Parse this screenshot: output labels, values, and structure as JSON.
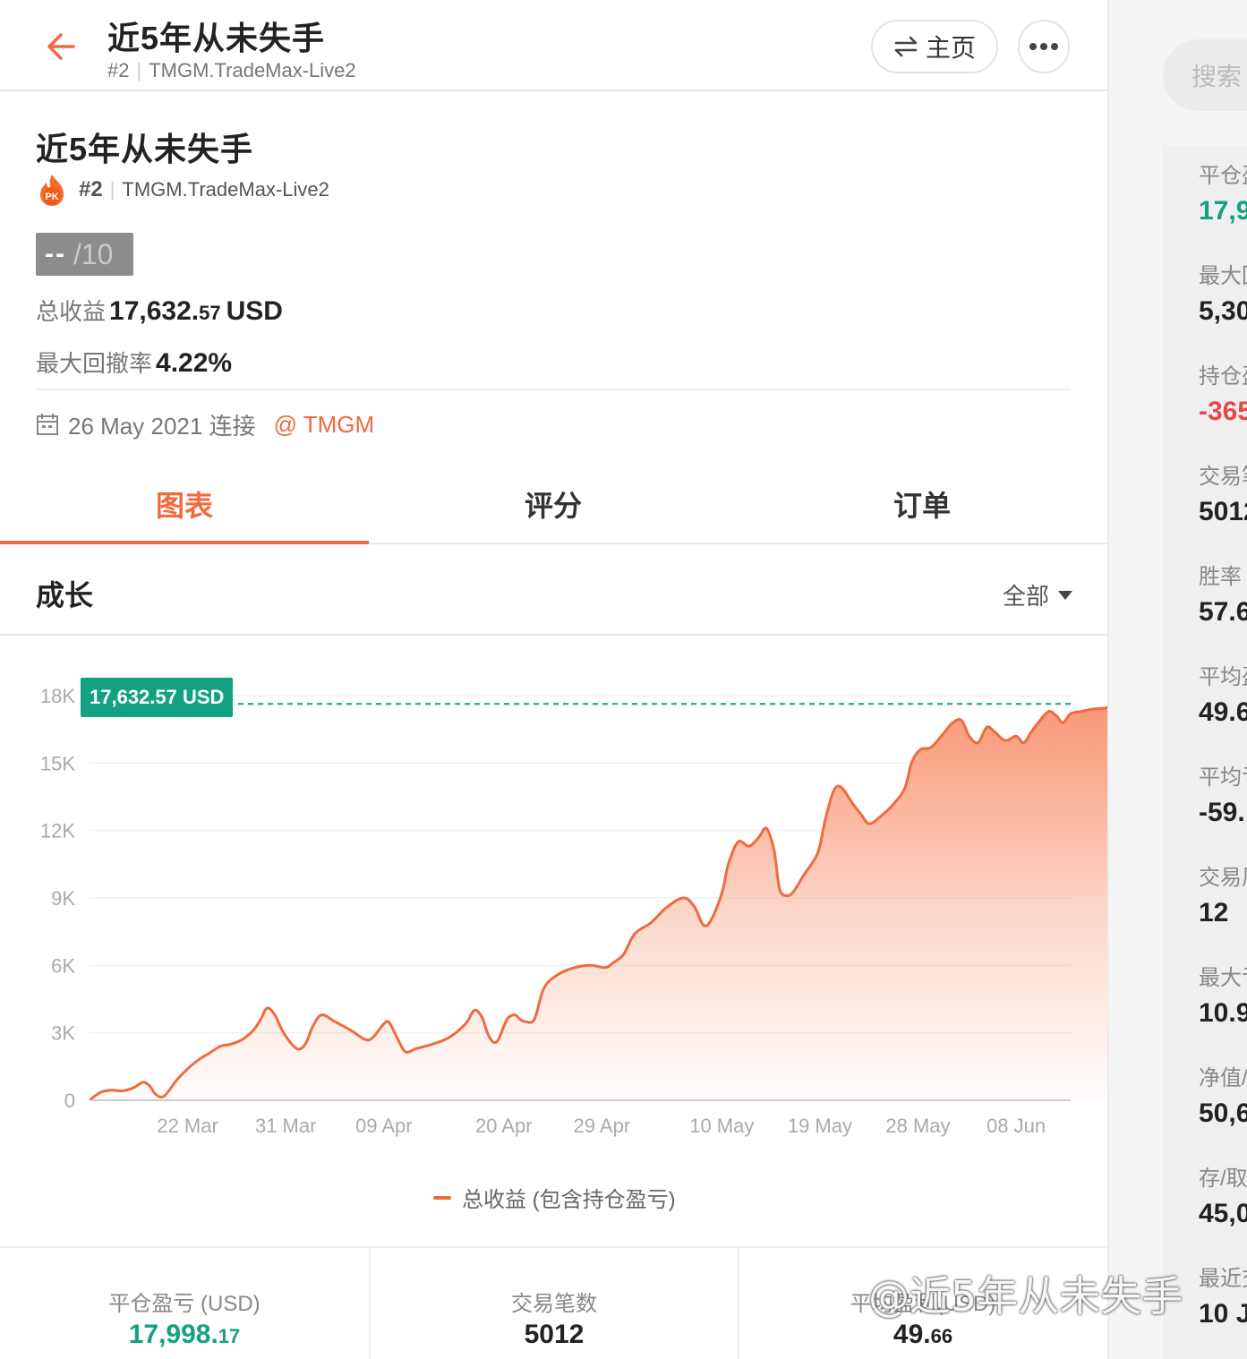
{
  "header": {
    "title": "近5年从未失手",
    "rank": "#2",
    "server": "TMGM.TradeMax-Live2",
    "home_label": "主页"
  },
  "profile": {
    "title": "近5年从未失手",
    "rank": "#2",
    "server": "TMGM.TradeMax-Live2",
    "score_dash": "--",
    "score_den": "/10",
    "total_profit_label": "总收益",
    "total_profit_int": "17,632.",
    "total_profit_frac": "57",
    "total_profit_unit": "USD",
    "drawdown_label": "最大回撤率",
    "drawdown_value": "4.22%",
    "connect_text": "26 May 2021 连接",
    "broker_link": "@ TMGM"
  },
  "tabs": [
    {
      "label": "图表",
      "active": true
    },
    {
      "label": "评分",
      "active": false
    },
    {
      "label": "订单",
      "active": false
    }
  ],
  "section": {
    "title": "成长",
    "range": "全部"
  },
  "chart_data": {
    "type": "area",
    "title": "",
    "legend": [
      "总收益 (包含持仓盈亏)"
    ],
    "current_value_tag": "17,632.57 USD",
    "y_ticks": [
      "0",
      "3K",
      "6K",
      "9K",
      "12K",
      "15K",
      "18K"
    ],
    "ylim": [
      0,
      18000
    ],
    "x_ticks": [
      "22 Mar",
      "31 Mar",
      "09 Apr",
      "20 Apr",
      "29 Apr",
      "10 May",
      "19 May",
      "28 May",
      "08 Jun"
    ],
    "x_tick_days": [
      9,
      18,
      27,
      38,
      47,
      58,
      67,
      76,
      85
    ],
    "x_range_days": [
      0,
      90
    ],
    "grid": true,
    "line_color": "#f06a3e",
    "fill_color": "#f7906a",
    "tag_color": "#13a182",
    "series": [
      {
        "name": "总收益 (包含持仓盈亏)",
        "points": [
          [
            0,
            0
          ],
          [
            1,
            350
          ],
          [
            2,
            450
          ],
          [
            3,
            420
          ],
          [
            4,
            550
          ],
          [
            4.5,
            700
          ],
          [
            5,
            800
          ],
          [
            5.5,
            650
          ],
          [
            6,
            300
          ],
          [
            6.5,
            150
          ],
          [
            7,
            250
          ],
          [
            8,
            900
          ],
          [
            9,
            1400
          ],
          [
            10,
            1800
          ],
          [
            11,
            2100
          ],
          [
            12,
            2400
          ],
          [
            13,
            2500
          ],
          [
            14,
            2700
          ],
          [
            15,
            3100
          ],
          [
            15.7,
            3600
          ],
          [
            16.3,
            4100
          ],
          [
            17,
            3800
          ],
          [
            17.8,
            3000
          ],
          [
            19,
            2300
          ],
          [
            19.8,
            2500
          ],
          [
            20.5,
            3300
          ],
          [
            21.3,
            3800
          ],
          [
            22.5,
            3500
          ],
          [
            24,
            3100
          ],
          [
            25.3,
            2700
          ],
          [
            26,
            2800
          ],
          [
            27,
            3400
          ],
          [
            27.5,
            3450
          ],
          [
            28.3,
            2700
          ],
          [
            29,
            2150
          ],
          [
            30,
            2300
          ],
          [
            31.5,
            2500
          ],
          [
            33,
            2800
          ],
          [
            34.5,
            3400
          ],
          [
            35.3,
            4000
          ],
          [
            36,
            3700
          ],
          [
            36.5,
            3000
          ],
          [
            37,
            2600
          ],
          [
            37.5,
            2700
          ],
          [
            38.3,
            3600
          ],
          [
            39,
            3800
          ],
          [
            39.5,
            3600
          ],
          [
            40,
            3500
          ],
          [
            40.8,
            3600
          ],
          [
            41.7,
            5000
          ],
          [
            43,
            5600
          ],
          [
            44.5,
            5900
          ],
          [
            46,
            6000
          ],
          [
            47.3,
            5900
          ],
          [
            48,
            6100
          ],
          [
            49,
            6500
          ],
          [
            50,
            7400
          ],
          [
            51.5,
            7900
          ],
          [
            53,
            8600
          ],
          [
            54.5,
            9000
          ],
          [
            55.5,
            8600
          ],
          [
            56.3,
            7800
          ],
          [
            57,
            8000
          ],
          [
            58,
            9200
          ],
          [
            58.6,
            10500
          ],
          [
            59.5,
            11500
          ],
          [
            60.5,
            11300
          ],
          [
            61.4,
            11700
          ],
          [
            62.1,
            12100
          ],
          [
            62.8,
            11100
          ],
          [
            63.3,
            9400
          ],
          [
            64,
            9100
          ],
          [
            64.6,
            9300
          ],
          [
            65.5,
            10000
          ],
          [
            66.8,
            11000
          ],
          [
            67.5,
            12500
          ],
          [
            68.3,
            13800
          ],
          [
            69,
            13900
          ],
          [
            70,
            13200
          ],
          [
            70.8,
            12700
          ],
          [
            71.5,
            12300
          ],
          [
            72.5,
            12600
          ],
          [
            73.8,
            13200
          ],
          [
            74.8,
            13900
          ],
          [
            75.4,
            15000
          ],
          [
            76.2,
            15600
          ],
          [
            77.2,
            15700
          ],
          [
            78.3,
            16300
          ],
          [
            79.2,
            16800
          ],
          [
            80,
            16900
          ],
          [
            80.7,
            16200
          ],
          [
            81.5,
            15900
          ],
          [
            82.3,
            16600
          ],
          [
            83,
            16400
          ],
          [
            84,
            16000
          ],
          [
            85,
            16200
          ],
          [
            85.7,
            15900
          ],
          [
            86.4,
            16400
          ],
          [
            87.2,
            16900
          ],
          [
            88,
            17300
          ],
          [
            88.7,
            17100
          ],
          [
            89.3,
            16800
          ],
          [
            90,
            17200
          ],
          [
            91,
            17300
          ],
          [
            92,
            17400
          ],
          [
            93.2,
            17450
          ],
          [
            93.8,
            17600
          ],
          [
            94.4,
            17950
          ],
          [
            95,
            17800
          ],
          [
            95.5,
            17632.57
          ]
        ]
      }
    ]
  },
  "bottom_stats": [
    {
      "label": "平仓盈亏 (USD)",
      "int": "17,998.",
      "frac": "17",
      "color": "green"
    },
    {
      "label": "交易笔数",
      "int": "5012",
      "frac": "",
      "color": "default"
    },
    {
      "label": "平均盈利(USD)",
      "int": "49.",
      "frac": "66",
      "color": "default"
    }
  ],
  "right_panel": {
    "search_placeholder": "搜索",
    "items": [
      {
        "label": "平仓盈",
        "value": "17,9",
        "color": "green"
      },
      {
        "label": "最大回",
        "value": "5,30",
        "color": "default"
      },
      {
        "label": "持仓盈",
        "value": "-365",
        "color": "red"
      },
      {
        "label": "交易笔",
        "value": "5012",
        "color": "default"
      },
      {
        "label": "胜率",
        "value": "57.6",
        "color": "default"
      },
      {
        "label": "平均盈",
        "value": "49.6",
        "color": "default"
      },
      {
        "label": "平均亏",
        "value": "-59.",
        "color": "default"
      },
      {
        "label": "交易周",
        "value": "12",
        "color": "default"
      },
      {
        "label": "最大亏",
        "value": "10.9",
        "color": "default"
      },
      {
        "label": "净值/",
        "value": "50,6",
        "color": "default"
      },
      {
        "label": "存/取",
        "value": "45,0",
        "color": "default"
      },
      {
        "label": "最近交",
        "value": "10 J",
        "color": "default"
      }
    ]
  },
  "watermark": "@近5年从未失手"
}
